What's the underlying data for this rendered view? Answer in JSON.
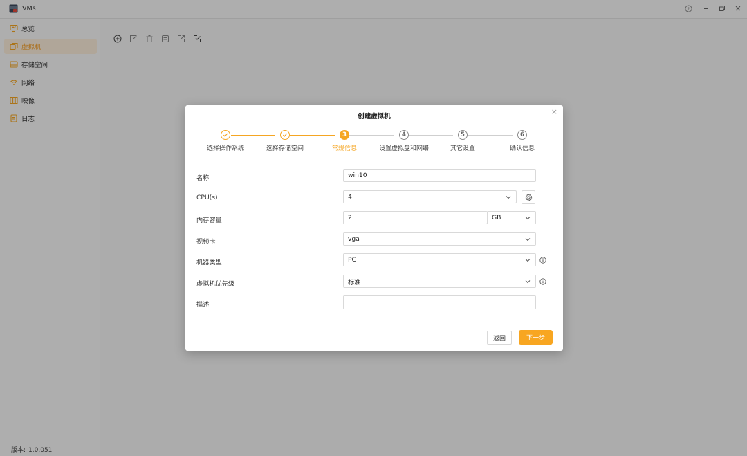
{
  "window": {
    "title": "VMs",
    "controls": [
      "help-icon",
      "minimize-icon",
      "restore-icon",
      "close-icon"
    ]
  },
  "sidebar": {
    "items": [
      {
        "label": "总览",
        "icon": "monitor-icon",
        "active": false
      },
      {
        "label": "虚拟机",
        "icon": "vm-icon",
        "active": true
      },
      {
        "label": "存储空间",
        "icon": "storage-icon",
        "active": false
      },
      {
        "label": "网络",
        "icon": "wifi-icon",
        "active": false
      },
      {
        "label": "映像",
        "icon": "image-icon",
        "active": false
      },
      {
        "label": "日志",
        "icon": "log-icon",
        "active": false
      }
    ],
    "version_label": "版本:",
    "version": "1.0.051"
  },
  "toolbar": {
    "buttons": [
      "add-icon",
      "edit-icon",
      "delete-icon",
      "clone-icon",
      "export-icon",
      "import-icon"
    ]
  },
  "dialog": {
    "title": "创建虚拟机",
    "steps": [
      {
        "index": "1",
        "label": "选择操作系统",
        "state": "done"
      },
      {
        "index": "2",
        "label": "选择存储空间",
        "state": "done"
      },
      {
        "index": "3",
        "label": "常规信息",
        "state": "current"
      },
      {
        "index": "4",
        "label": "设置虚拟盘和网络",
        "state": "todo"
      },
      {
        "index": "5",
        "label": "其它设置",
        "state": "todo"
      },
      {
        "index": "6",
        "label": "确认信息",
        "state": "todo"
      }
    ],
    "form": {
      "name": {
        "label": "名称",
        "value": "win10"
      },
      "cpu": {
        "label": "CPU(s)",
        "value": "4"
      },
      "memory": {
        "label": "内存容量",
        "value": "2",
        "unit": "GB"
      },
      "video": {
        "label": "视频卡",
        "value": "vga"
      },
      "machine": {
        "label": "机器类型",
        "value": "PC"
      },
      "priority": {
        "label": "虚拟机优先级",
        "value": "标准"
      },
      "description": {
        "label": "描述",
        "value": ""
      }
    },
    "buttons": {
      "back": "返回",
      "next": "下一步"
    }
  },
  "colors": {
    "accent": "#f5a623",
    "active_nav_bg": "#fdeedc",
    "overlay": "rgba(0,0,0,0.30)"
  }
}
